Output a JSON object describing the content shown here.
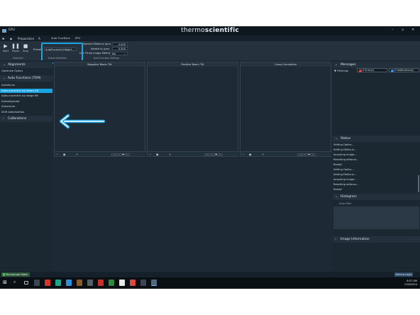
{
  "window": {
    "app_name": "EPU",
    "brand_regular": "thermo",
    "brand_bold": "scientific",
    "min": "–",
    "max": "▫",
    "close": "✕"
  },
  "menu": {
    "items": [
      "Preparation",
      "Auto Functions",
      "EPU"
    ],
    "short_a": "A"
  },
  "ribbon": {
    "start": "Start",
    "pause": "Pause",
    "stop": "Stop",
    "preset_label": "Preset",
    "tab_auto_functions": "Auto Functions",
    "tab_epu": "EPU",
    "dropdown_value": "AutoEucentricHeight",
    "desired_defocus_label": "Desired Defocus (µm)",
    "desired_defocus_value": "0.000",
    "iterate_label": "Iterate to (µm)",
    "iterate_value": "0.300",
    "three_image_label": "Use Three Image Method",
    "three_image_value": "No",
    "group_selection": "Selection",
    "group_preset": "Preset Selection",
    "group_settings": "Auto Function Settings"
  },
  "sidebar": {
    "alignments": "Alignments",
    "optimize_optics": "Optimize Optics",
    "auto_functions": "Auto Functions (TEM)",
    "items": [
      "Autofocus",
      "Auto-eucentric by beam tilt",
      "Auto-eucentric by stage tilt",
      "Autostigmate",
      "Autocoma",
      "Drift stabilization"
    ],
    "calibrations": "Calibrations"
  },
  "panels": [
    "Negative Beam Tilt",
    "Positive Beam Tilt",
    "Cross-Correlation"
  ],
  "right": {
    "messages": "Messages",
    "filtering": "Filtering:",
    "errors": "0 Error(s)",
    "notifications": "0 Notification(s)",
    "status": "Status",
    "status_lines": [
      "Setting Optics...",
      "Setting Defocus...",
      "Acquiring image...",
      "Resetting defocus...",
      "Ready!",
      "Setting Optics...",
      "Setting Defocus...",
      "Acquiring image...",
      "Resetting defocus...",
      "Ready!"
    ],
    "histogram": "Histogram",
    "auto_filter": "Auto Filter",
    "image_info": "Image Information"
  },
  "statusbar": {
    "microscope_state": "Microscope State",
    "login": "Athena Login"
  },
  "taskbar": {
    "time": "8:57 AM",
    "date": "7/18/2024"
  },
  "colors": {
    "accent": "#1ba5e0",
    "error": "#e0453a",
    "notification": "#3a8fe0"
  }
}
